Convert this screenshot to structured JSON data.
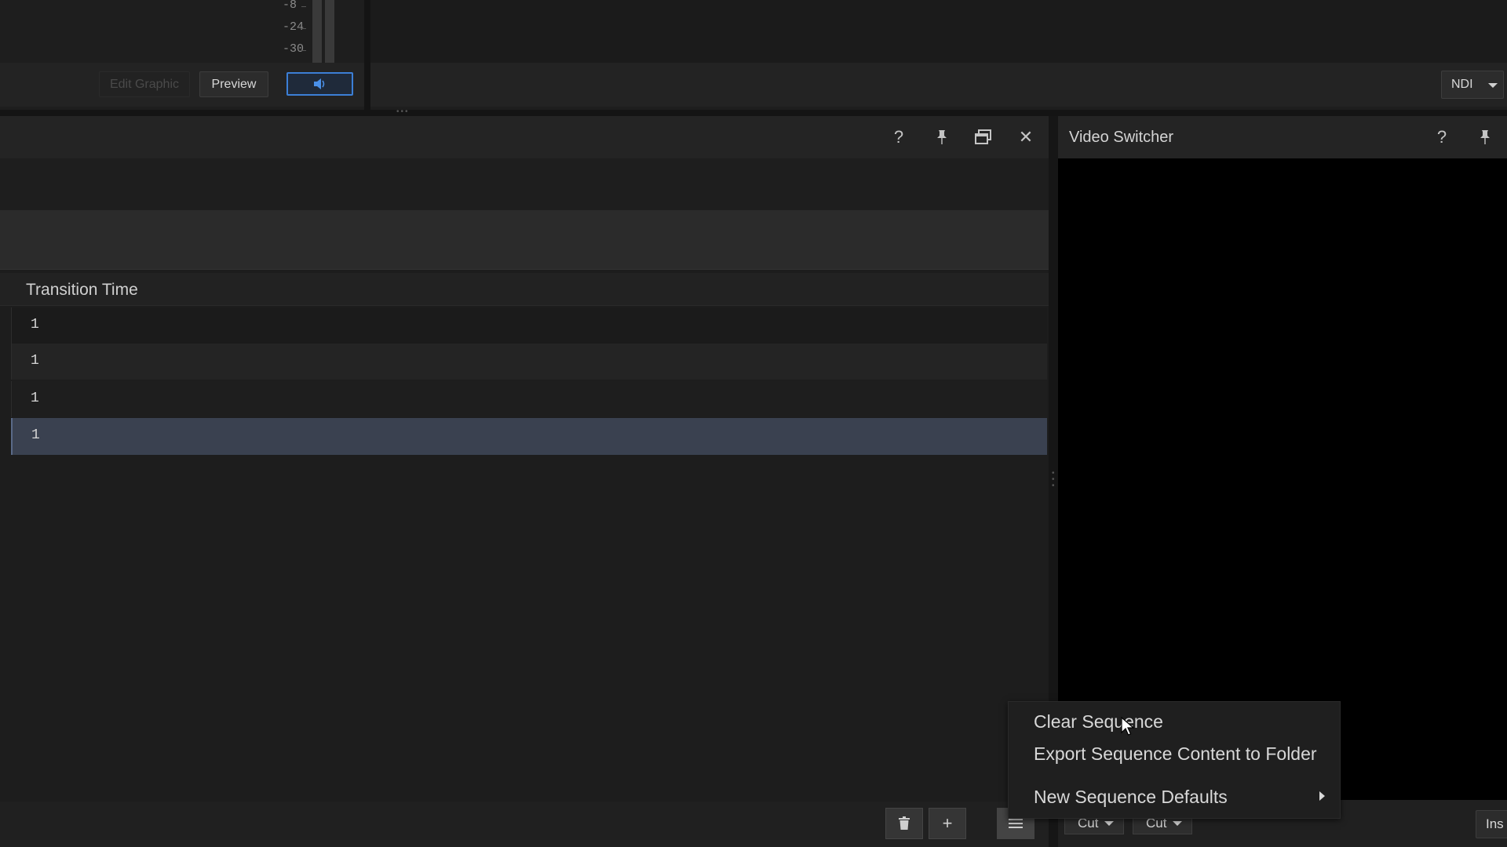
{
  "top": {
    "meter_scale": [
      "-8",
      "-24",
      "-30"
    ],
    "edit_graphic_label": "Edit Graphic",
    "preview_label": "Preview",
    "speaker_icon": "speaker-icon",
    "ndi_label": "NDI"
  },
  "left_panel": {
    "header_icons": [
      "help-icon",
      "pin-icon",
      "restore-window-icon",
      "close-icon"
    ],
    "help_glyph": "?",
    "close_glyph": "✕",
    "table": {
      "column_header": "Transition Time",
      "rows": [
        "1",
        "1",
        "1",
        "1"
      ],
      "selected_row_index": 3
    },
    "bottom_buttons": [
      "trash-icon",
      "plus-icon",
      "menu-icon"
    ],
    "plus_glyph": "+"
  },
  "right_panel": {
    "title": "Video Switcher",
    "help_glyph": "?",
    "transition_a": "Cut",
    "transition_b": "Cut",
    "ins_label": "Ins"
  },
  "context_menu": {
    "items": [
      "Clear Sequence",
      "Export Sequence Content to Folder",
      "New Sequence Defaults"
    ]
  },
  "colors": {
    "selected_row": "#3a4150",
    "accent_blue": "#3c7fd6",
    "video_bg": "#000000"
  }
}
